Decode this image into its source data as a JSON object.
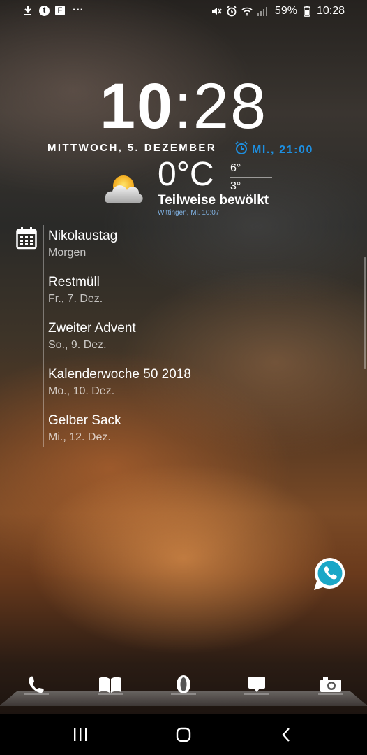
{
  "status_bar": {
    "left_icons": [
      "download-icon",
      "t-app-icon",
      "flipboard-icon",
      "more-icon"
    ],
    "right_icons": [
      "mute-icon",
      "alarm-icon",
      "wifi-icon",
      "signal-icon"
    ],
    "battery": "59%",
    "time": "10:28"
  },
  "clock": {
    "hour": "10",
    "separator": ":",
    "minute": "28"
  },
  "date": "MITTWOCH, 5. DEZEMBER",
  "alarm": {
    "label": "MI., 21:00",
    "color": "#1e8fe0"
  },
  "weather": {
    "icon": "partly-cloudy-icon",
    "temp": "0°C",
    "high": "6°",
    "low": "3°",
    "description": "Teilweise bewölkt",
    "location": "Wittingen, Mi. 10:07"
  },
  "calendar": {
    "events": [
      {
        "title": "Nikolaustag",
        "date": "Morgen"
      },
      {
        "title": "Restmüll",
        "date": "Fr., 7. Dez."
      },
      {
        "title": "Zweiter Advent",
        "date": "So., 9. Dez."
      },
      {
        "title": "Kalenderwoche 50 2018",
        "date": "Mo., 10. Dez."
      },
      {
        "title": "Gelber Sack",
        "date": "Mi., 12. Dez."
      }
    ]
  },
  "floating_app": "whatsapp-icon",
  "dock": [
    "phone-icon",
    "book-icon",
    "opera-icon",
    "chat-icon",
    "camera-icon"
  ],
  "navigation": [
    "recents-button",
    "home-button",
    "back-button"
  ]
}
